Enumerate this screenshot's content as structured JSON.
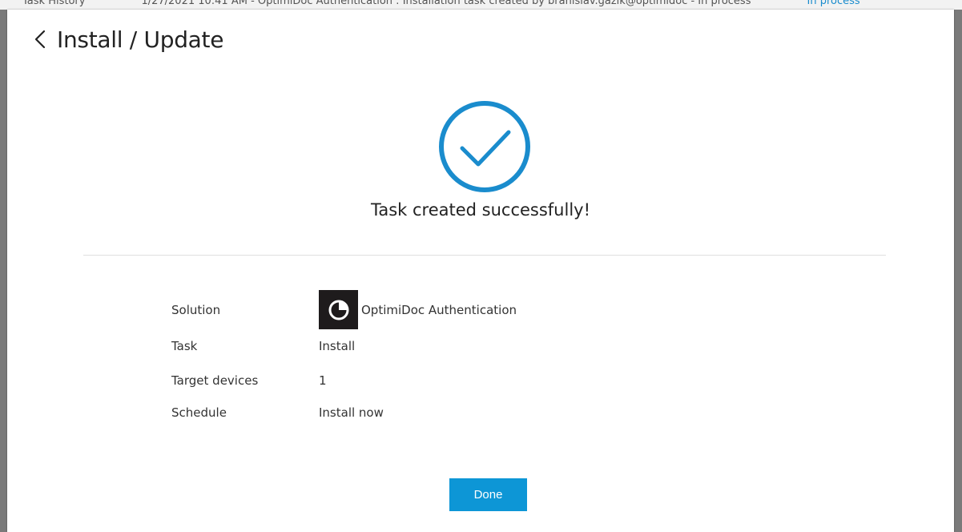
{
  "header": {
    "title": "Install / Update",
    "back_icon": "chevron-left-icon"
  },
  "success": {
    "icon": "checkmark-circle-icon",
    "message": "Task created successfully!",
    "accent_color": "#1a8ccd"
  },
  "details": [
    {
      "label": "Solution",
      "value": "OptimiDoc Authentication",
      "icon": "optimidoc-logo-icon"
    },
    {
      "label": "Task",
      "value": "Install"
    },
    {
      "label": "Target devices",
      "value": "1"
    },
    {
      "label": "Schedule",
      "value": "Install now"
    }
  ],
  "actions": {
    "done_label": "Done",
    "button_color": "#0d96d6"
  }
}
